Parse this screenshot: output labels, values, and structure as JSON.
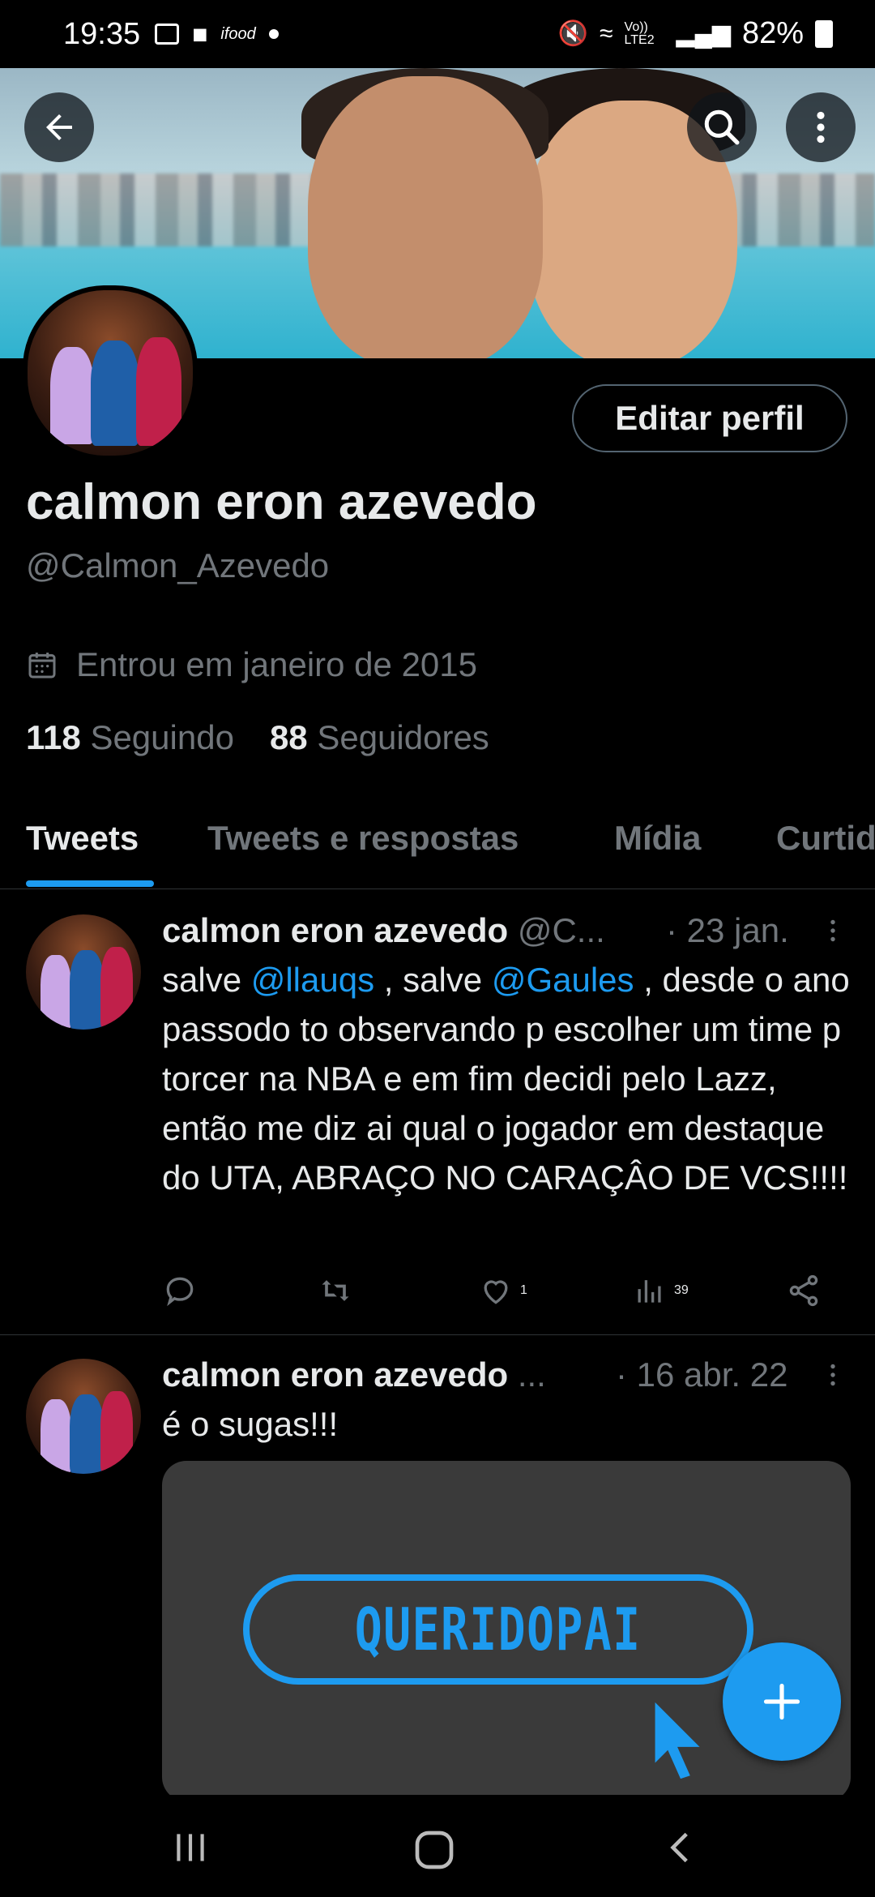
{
  "status_bar": {
    "time": "19:35",
    "battery_percent": "82%",
    "network_label": "Vo)) LTE2",
    "icons": [
      "gallery-icon",
      "message-icon",
      "ifood-icon",
      "dot-icon",
      "mute-icon",
      "wifi-icon",
      "signal-icon",
      "battery-icon"
    ]
  },
  "header": {
    "back_icon": "arrow-left-icon",
    "search_icon": "search-icon",
    "more_icon": "more-vertical-icon"
  },
  "profile": {
    "edit_button": "Editar perfil",
    "name": "calmon eron azevedo",
    "handle": "@Calmon_Azevedo",
    "joined": "Entrou em janeiro de 2015",
    "following_count": "118",
    "following_label": "Seguindo",
    "followers_count": "88",
    "followers_label": "Seguidores"
  },
  "tabs": [
    {
      "label": "Tweets",
      "active": true
    },
    {
      "label": "Tweets e respostas",
      "active": false
    },
    {
      "label": "Mídia",
      "active": false
    },
    {
      "label": "Curtid",
      "active": false
    }
  ],
  "tweets": [
    {
      "author": "calmon eron azevedo",
      "handle": "@C...",
      "date": "· 23 jan.",
      "text_parts": [
        "salve ",
        "@llauqs",
        " , salve ",
        "@Gaules",
        " , desde o ano passodo to observando p escolher um time p torcer na NBA e em fim decidi pelo Lazz, então me diz ai qual o jogador em destaque do UTA, ABRAÇO NO CARAÇÂO DE VCS!!!!"
      ],
      "likes": "1",
      "views": "39"
    },
    {
      "author": "calmon eron azevedo",
      "handle": "...",
      "date": "· 16 abr. 22",
      "text": "é o sugas!!!",
      "media_text": "QUERIDOPAI"
    }
  ],
  "colors": {
    "accent": "#1d9bf0",
    "background": "#000000",
    "secondary_text": "#71767b",
    "divider": "#2f3336"
  }
}
